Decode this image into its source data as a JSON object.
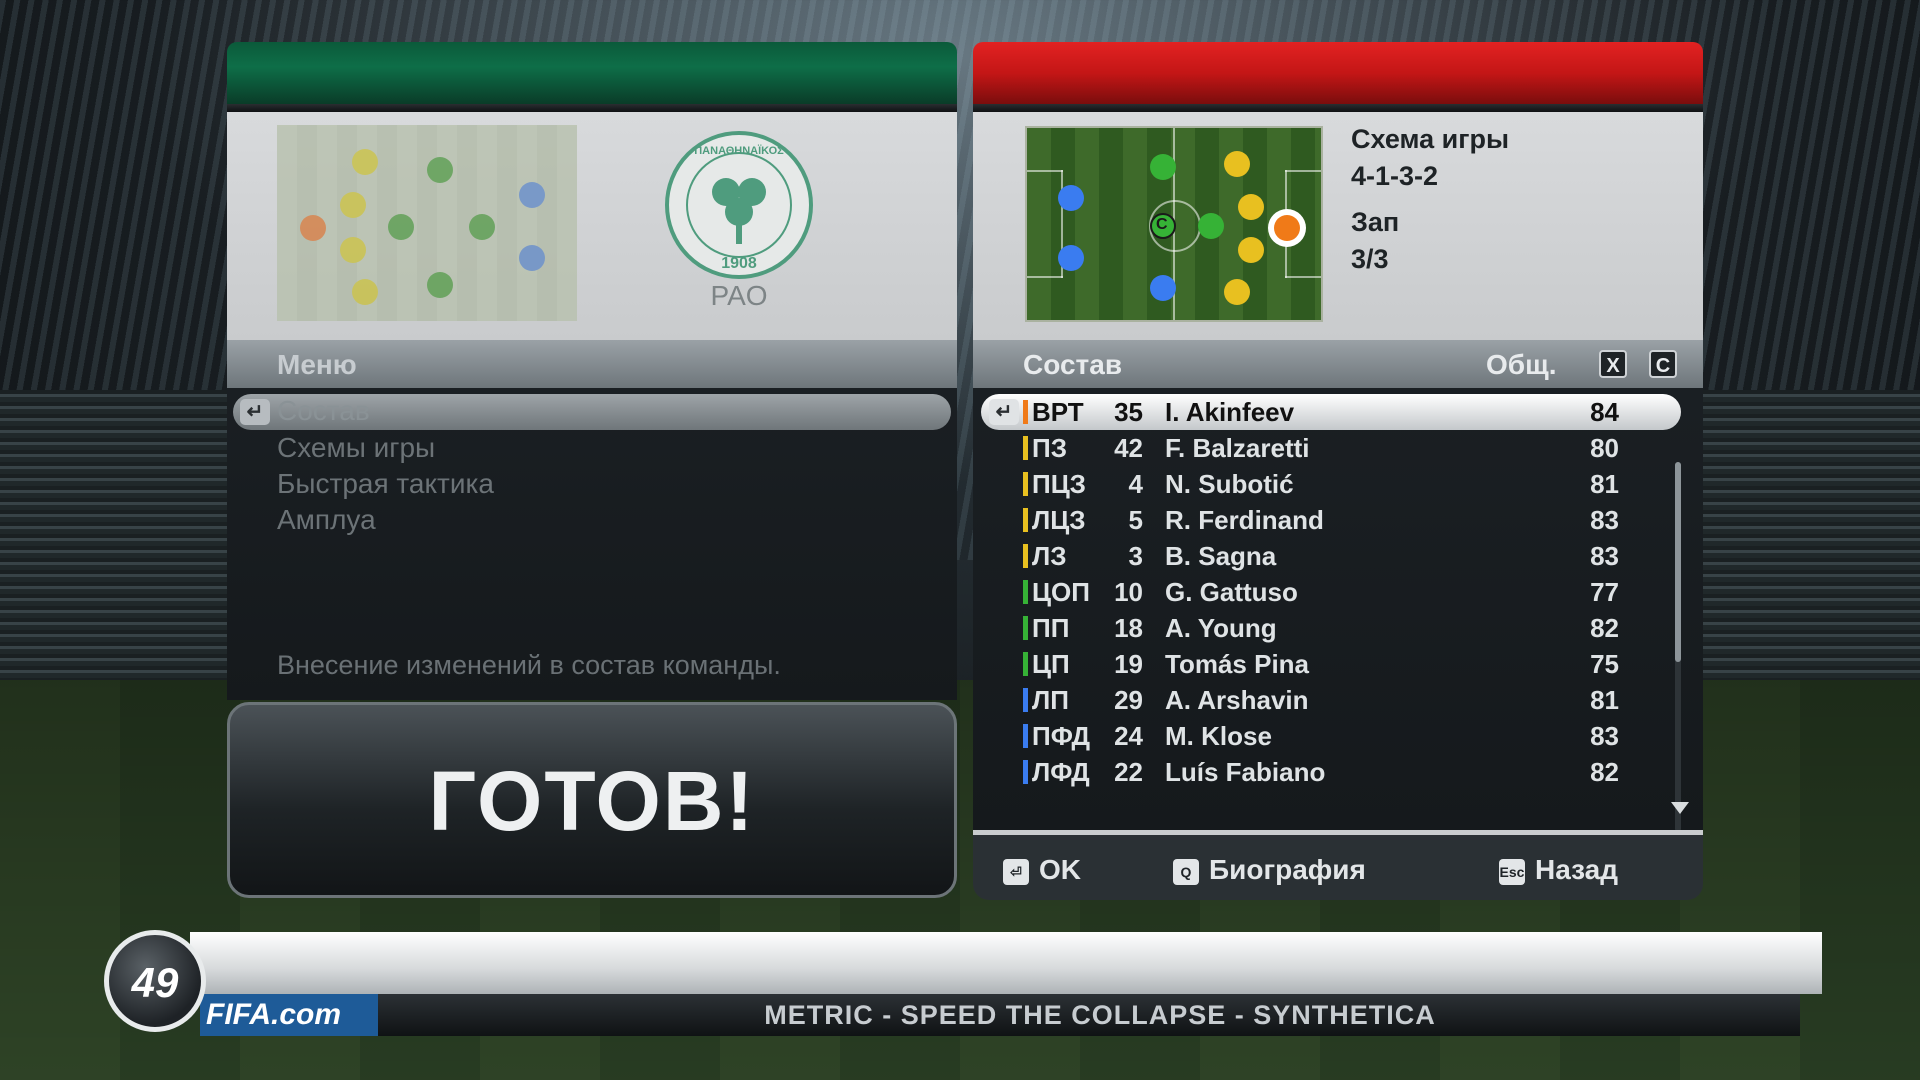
{
  "left_panel": {
    "team_label": "PAO",
    "crest_text": "ΠΑΝΑΘΗΝΑΪΚΟΣ",
    "crest_year": "1908",
    "menu_title": "Меню",
    "menu_items": [
      "Состав",
      "Схемы игры",
      "Быстрая тактика",
      "Амплуа"
    ],
    "hint": "Внесение изменений в состав команды.",
    "ready_button": "ГОТОВ!"
  },
  "right_panel": {
    "formation_label": "Схема игры",
    "formation_value": "4-1-3-2",
    "sub_label": "Зап",
    "sub_value": "3/3",
    "squad_title": "Состав",
    "overall_label": "Общ.",
    "key_x": "X",
    "key_c": "C",
    "captain_mark": "C",
    "players": [
      {
        "pos": "ВРТ",
        "num": "35",
        "name": "I. Akinfeev",
        "ovr": "84",
        "color": "#f07a18"
      },
      {
        "pos": "ПЗ",
        "num": "42",
        "name": "F. Balzaretti",
        "ovr": "80",
        "color": "#e8c020"
      },
      {
        "pos": "ПЦЗ",
        "num": "4",
        "name": "N. Subotić",
        "ovr": "81",
        "color": "#e8c020"
      },
      {
        "pos": "ЛЦЗ",
        "num": "5",
        "name": "R. Ferdinand",
        "ovr": "83",
        "color": "#e8c020"
      },
      {
        "pos": "ЛЗ",
        "num": "3",
        "name": "B. Sagna",
        "ovr": "83",
        "color": "#e8c020"
      },
      {
        "pos": "ЦОП",
        "num": "10",
        "name": "G. Gattuso",
        "ovr": "77",
        "color": "#36b236"
      },
      {
        "pos": "ПП",
        "num": "18",
        "name": "A. Young",
        "ovr": "82",
        "color": "#36b236"
      },
      {
        "pos": "ЦП",
        "num": "19",
        "name": "Tomás Pina",
        "ovr": "75",
        "color": "#36b236"
      },
      {
        "pos": "ЛП",
        "num": "29",
        "name": "A. Arshavin",
        "ovr": "81",
        "color": "#3a7cf0"
      },
      {
        "pos": "ПФД",
        "num": "24",
        "name": "M. Klose",
        "ovr": "83",
        "color": "#3a7cf0"
      },
      {
        "pos": "ЛФД",
        "num": "22",
        "name": "Luís Fabiano",
        "ovr": "82",
        "color": "#3a7cf0"
      }
    ],
    "footer": {
      "ok_key": "⏎",
      "ok_label": "OK",
      "bio_key": "Q",
      "bio_label": "Биография",
      "back_key": "Esc",
      "back_label": "Назад"
    }
  },
  "bottom_bar": {
    "badge_number": "49",
    "site": "FIFA.com",
    "now_playing": "METRIC - SPEED THE COLLAPSE - SYNTHETICA"
  },
  "colors": {
    "left_cap": "#0e6e48",
    "right_cap": "#d41a1a",
    "gk": "#f07a18",
    "def": "#e8c020",
    "mid": "#36b236",
    "att": "#3a7cf0"
  }
}
